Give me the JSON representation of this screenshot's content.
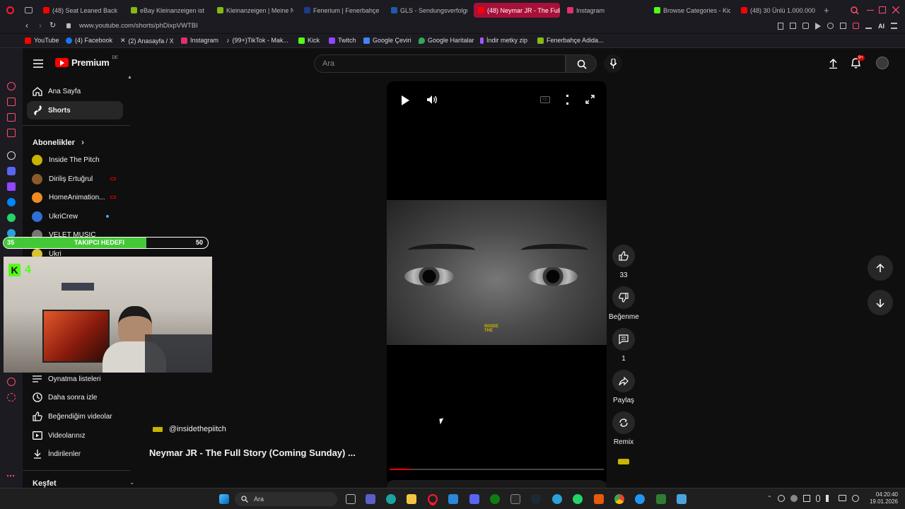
{
  "browser": {
    "tabs": [
      {
        "label": "(48) Seat Leaned Back P",
        "color": "#ff0000"
      },
      {
        "label": "eBay Kleinanzeigen ist je",
        "color": "#86b817"
      },
      {
        "label": "Kleinanzeigen | Meine N",
        "color": "#86b817"
      },
      {
        "label": "Fenerium | Fenerbahçe 2",
        "color": "#1e3a8a"
      },
      {
        "label": "GLS - Sendungsverfolgu",
        "color": "#1e5aa8"
      },
      {
        "label": "(48) Neymar JR - The Full",
        "color": "#ff0000"
      },
      {
        "label": "Instagram",
        "color": "#e1306c"
      },
      {
        "label": "Browse Categories - Kic",
        "color": "#53fc18"
      },
      {
        "label": "(48) 30 Ünlü 1.000.000 D",
        "color": "#ff0000"
      }
    ],
    "url": "www.youtube.com/shorts/phDixpVWTBI",
    "extension_label": "AI",
    "bookmarks": [
      {
        "label": "YouTube",
        "color": "#ff0000"
      },
      {
        "label": "(4) Facebook",
        "color": "#1877f2"
      },
      {
        "label": "(2) Anasayfa / X",
        "color": "#ffffff"
      },
      {
        "label": "Instagram",
        "color": "#e1306c"
      },
      {
        "label": "(99+)TikTok - Mak...",
        "color": "#ffffff"
      },
      {
        "label": "Kick",
        "color": "#53fc18"
      },
      {
        "label": "Twitch",
        "color": "#9146ff"
      },
      {
        "label": "Google Çeviri",
        "color": "#4285f4"
      },
      {
        "label": "Google Haritalar",
        "color": "#34a853"
      },
      {
        "label": "İndir metky zip",
        "color": "#a259ff"
      },
      {
        "label": "Fenerbahçe Adida...",
        "color": "#86b817"
      }
    ]
  },
  "youtube": {
    "logo": "Premium",
    "logo_country": "DE",
    "search_placeholder": "Ara",
    "notification_count": "9+",
    "sidebar": {
      "main": [
        {
          "label": "Ana Sayfa",
          "icon": "home-icon"
        },
        {
          "label": "Shorts",
          "icon": "shorts-icon"
        }
      ],
      "subs_title": "Abonelikler",
      "subscriptions": [
        {
          "label": "Inside The Pitch",
          "color": "#c9b400"
        },
        {
          "label": "Diriliş Ertuğrul",
          "color": "#8b5a2b"
        },
        {
          "label": "HomeAnimation...",
          "color": "#f08a24"
        },
        {
          "label": "UkriCrew",
          "color": "#2f6fd6"
        },
        {
          "label": "VELET MUSIC",
          "color": "#777777"
        },
        {
          "label": "Ukri",
          "color": "#d6c32f"
        }
      ],
      "you_items": [
        {
          "label": "Oynatma listeleri",
          "icon": "playlist-icon"
        },
        {
          "label": "Daha sonra izle",
          "icon": "clock-icon"
        },
        {
          "label": "Beğendiğim videolar",
          "icon": "thumbs-up-icon"
        },
        {
          "label": "Videolarınız",
          "icon": "video-icon"
        },
        {
          "label": "İndirilenler",
          "icon": "download-icon"
        }
      ],
      "explore_title": "Keşfet"
    },
    "short": {
      "channel": "@insidethepiitch",
      "title": "Neymar JR - The Full Story (Coming Sunday) ...",
      "overlay_text_1": "INSIDE",
      "overlay_text_2": "THE",
      "progress": 0.1,
      "actions": {
        "likes": "33",
        "dislike_label": "Beğenme",
        "comments": "1",
        "share_label": "Paylaş",
        "remix_label": "Remix"
      }
    }
  },
  "stream_overlay": {
    "goal_label": "TAKIPCI HEDEFI",
    "goal_current": "35",
    "goal_target": "50",
    "kick_count": "4"
  },
  "taskbar": {
    "search_label": "Ara",
    "time": "04:20:40",
    "date": "19.01.2026"
  }
}
